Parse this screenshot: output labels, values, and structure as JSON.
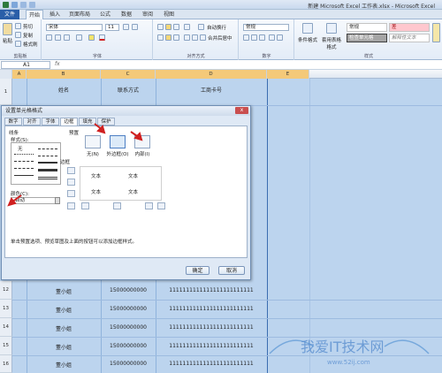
{
  "titlebar": {
    "title": "新建 Microsoft Excel 工作表.xlsx - Microsoft Excel"
  },
  "tabs": {
    "file": "文件",
    "items": [
      "开始",
      "插入",
      "页面布局",
      "公式",
      "数据",
      "审阅",
      "视图"
    ]
  },
  "ribbon": {
    "clipboard": {
      "paste": "粘贴",
      "cut": "剪切",
      "copy": "复制",
      "format_painter": "格式刷",
      "label": "剪贴板"
    },
    "font": {
      "name": "宋体",
      "size": "11",
      "label": "字体"
    },
    "alignment": {
      "wrap": "自动换行",
      "merge": "合并后居中",
      "label": "对齐方式"
    },
    "number": {
      "format": "常规",
      "label": "数字"
    },
    "styles": {
      "conditional": "条件格式",
      "table": "套用表格格式",
      "normal": "常规",
      "bad": "差",
      "check": "检查单元格",
      "explanatory": "解释性文本",
      "label": "样式"
    }
  },
  "formula": {
    "namebox": "A1",
    "fx": "fx"
  },
  "sheet": {
    "columns": [
      "A",
      "B",
      "C",
      "D",
      "E"
    ],
    "headers": {
      "name": "姓名",
      "contact": "联系方式",
      "bank": "工商卡号"
    },
    "rows": [
      {
        "num": "1"
      },
      {
        "num": "12",
        "name": "董小姐",
        "phone": "15000000000",
        "card": "1111111111111111111111111"
      },
      {
        "num": "13",
        "name": "董小姐",
        "phone": "15000000000",
        "card": "1111111111111111111111111"
      },
      {
        "num": "14",
        "name": "董小姐",
        "phone": "15000000000",
        "card": "1111111111111111111111111"
      },
      {
        "num": "15",
        "name": "董小姐",
        "phone": "15000000000",
        "card": "1111111111111111111111111"
      },
      {
        "num": "16",
        "name": "董小姐",
        "phone": "15000000000",
        "card": "1111111111111111111111111"
      },
      {
        "num": "17",
        "name": "董小姐",
        "phone": "15000000000",
        "card": "1111111111111111111111111"
      },
      {
        "num": "18",
        "name": "董小姐",
        "phone": "15000000000",
        "card": "1111111111111111111111111"
      }
    ]
  },
  "dialog": {
    "title": "设置单元格格式",
    "close": "x",
    "tabs": [
      "数字",
      "对齐",
      "字体",
      "边框",
      "填充",
      "保护"
    ],
    "line_group": "线条",
    "style_label": "样式(S):",
    "none_label": "无",
    "color_label": "颜色(C):",
    "color_value": "自动",
    "presets_label": "预置",
    "preset_none": "无(N)",
    "preset_outline": "外边框(O)",
    "preset_inside": "内部(I)",
    "border_label": "边框",
    "preview_text": "文本",
    "hint": "单击预置选项、预览草图及上面的按钮可以添加边框样式。",
    "ok": "确定",
    "cancel": "取消"
  },
  "colors": {
    "accent": "#2a5ea8",
    "selection": "#bcd4ee",
    "arrow": "#d02020"
  }
}
